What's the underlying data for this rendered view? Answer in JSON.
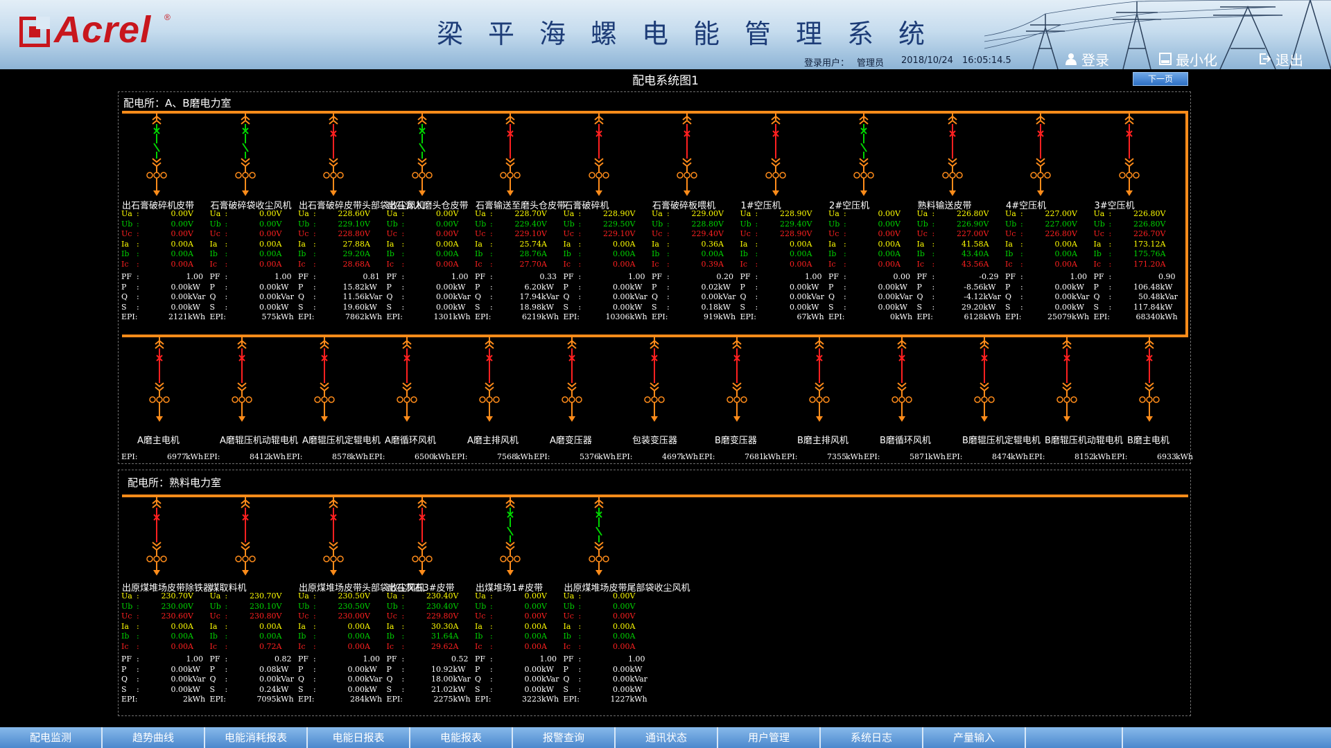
{
  "header": {
    "logo_text": "Acrel",
    "logo_reg": "®",
    "app_title": "梁平海螺电能管理系统",
    "user_label": "登录用户：",
    "user_name": "管理员",
    "date": "2018/10/24",
    "time": "16:05:14.5",
    "login_label": "登录",
    "minimize_label": "最小化",
    "exit_label": "退出"
  },
  "page_title": "配电系统图1",
  "next_page_label": "下一页",
  "colors": {
    "bus": "#ff8c1a",
    "closed": "#00d400",
    "open": "#ff2020",
    "ua": "#ffff00",
    "ub": "#00d400",
    "uc": "#ff2020"
  },
  "section1": {
    "title": "配电所：A、B磨电力室",
    "feeders": [
      {
        "name": "出石膏破碎机皮带",
        "state": "closed",
        "ua": "0.00",
        "ub": "0.00",
        "uc": "0.00",
        "ia": "0.00",
        "ib": "0.00",
        "ic": "0.00",
        "pf": "1.00",
        "p": "0.00",
        "q": "0.00",
        "s": "0.00",
        "epi": "2121"
      },
      {
        "name": "石膏破碎袋收尘风机",
        "state": "closed",
        "ua": "0.00",
        "ub": "0.00",
        "uc": "0.00",
        "ia": "0.00",
        "ib": "0.00",
        "ic": "0.00",
        "pf": "1.00",
        "p": "0.00",
        "q": "0.00",
        "s": "0.00",
        "epi": "575"
      },
      {
        "name": "出石膏破碎皮带头部袋收尘风机",
        "state": "open",
        "ua": "228.60",
        "ub": "229.10",
        "uc": "228.80",
        "ia": "27.88",
        "ib": "29.20",
        "ic": "28.68",
        "pf": "0.81",
        "p": "15.82",
        "q": "11.56",
        "s": "19.60",
        "epi": "7862"
      },
      {
        "name": "出石膏入磨头仓皮带",
        "state": "closed",
        "ua": "0.00",
        "ub": "0.00",
        "uc": "0.00",
        "ia": "0.00",
        "ib": "0.00",
        "ic": "0.00",
        "pf": "1.00",
        "p": "0.00",
        "q": "0.00",
        "s": "0.00",
        "epi": "1301"
      },
      {
        "name": "石膏输送至磨头仓皮带",
        "state": "open",
        "ua": "228.70",
        "ub": "229.40",
        "uc": "229.10",
        "ia": "25.74",
        "ib": "28.76",
        "ic": "27.70",
        "pf": "0.33",
        "p": "6.20",
        "q": "17.94",
        "s": "18.98",
        "epi": "6219"
      },
      {
        "name": "石膏破碎机",
        "state": "open",
        "ua": "228.90",
        "ub": "229.50",
        "uc": "229.10",
        "ia": "0.00",
        "ib": "0.00",
        "ic": "0.00",
        "pf": "1.00",
        "p": "0.00",
        "q": "0.00",
        "s": "0.00",
        "epi": "10306"
      },
      {
        "name": "石膏破碎板喂机",
        "state": "open",
        "ua": "229.00",
        "ub": "228.80",
        "uc": "229.40",
        "ia": "0.36",
        "ib": "0.00",
        "ic": "0.39",
        "pf": "0.20",
        "p": "0.02",
        "q": "0.00",
        "s": "0.18",
        "epi": "919"
      },
      {
        "name": "1#空压机",
        "state": "open",
        "ua": "228.90",
        "ub": "229.40",
        "uc": "228.90",
        "ia": "0.00",
        "ib": "0.00",
        "ic": "0.00",
        "pf": "1.00",
        "p": "0.00",
        "q": "0.00",
        "s": "0.00",
        "epi": "67"
      },
      {
        "name": "2#空压机",
        "state": "closed",
        "ua": "0.00",
        "ub": "0.00",
        "uc": "0.00",
        "ia": "0.00",
        "ib": "0.00",
        "ic": "0.00",
        "pf": "0.00",
        "p": "0.00",
        "q": "0.00",
        "s": "0.00",
        "epi": "0"
      },
      {
        "name": "熟料输送皮带",
        "state": "open",
        "ua": "226.80",
        "ub": "226.90",
        "uc": "227.00",
        "ia": "41.58",
        "ib": "43.40",
        "ic": "43.56",
        "pf": "-0.29",
        "p": "-8.56",
        "q": "-4.12",
        "s": "29.20",
        "epi": "6128"
      },
      {
        "name": "4#空压机",
        "state": "open",
        "ua": "227.00",
        "ub": "227.00",
        "uc": "226.80",
        "ia": "0.00",
        "ib": "0.00",
        "ic": "0.00",
        "pf": "1.00",
        "p": "0.00",
        "q": "0.00",
        "s": "0.00",
        "epi": "25079"
      },
      {
        "name": "3#空压机",
        "state": "open",
        "ua": "226.80",
        "ub": "226.80",
        "uc": "226.70",
        "ia": "173.12",
        "ib": "175.76",
        "ic": "171.20",
        "pf": "0.90",
        "p": "106.48",
        "q": "50.48",
        "s": "117.84",
        "epi": "68340"
      }
    ],
    "lower_feeders": [
      {
        "name": "A磨主电机",
        "epi": "6977"
      },
      {
        "name": "A磨辊压机动辊电机",
        "epi": "8412"
      },
      {
        "name": "A磨辊压机定辊电机",
        "epi": "8578"
      },
      {
        "name": "A磨循环风机",
        "epi": "6500"
      },
      {
        "name": "A磨主排风机",
        "epi": "7568"
      },
      {
        "name": "A磨变压器",
        "epi": "5376"
      },
      {
        "name": "包装变压器",
        "epi": "4697"
      },
      {
        "name": "B磨变压器",
        "epi": "7681"
      },
      {
        "name": "B磨主排风机",
        "epi": "7355"
      },
      {
        "name": "B磨循环风机",
        "epi": "5871"
      },
      {
        "name": "B磨辊压机定辊电机",
        "epi": "8474"
      },
      {
        "name": "B磨辊压机动辊电机",
        "epi": "8152"
      },
      {
        "name": "B磨主电机",
        "epi": "6933"
      }
    ]
  },
  "section2": {
    "title": "配电所：熟料电力室",
    "feeders": [
      {
        "name": "出原煤堆场皮带除铁器",
        "state": "open",
        "ua": "230.70",
        "ub": "230.00",
        "uc": "230.60",
        "ia": "0.00",
        "ib": "0.00",
        "ic": "0.00",
        "pf": "1.00",
        "p": "0.00",
        "q": "0.00",
        "s": "0.00",
        "epi": "2"
      },
      {
        "name": "煤取料机",
        "state": "open",
        "ua": "230.70",
        "ub": "230.10",
        "uc": "230.80",
        "ia": "0.00",
        "ib": "0.00",
        "ic": "0.72",
        "pf": "0.82",
        "p": "0.08",
        "q": "0.00",
        "s": "0.24",
        "epi": "7095"
      },
      {
        "name": "出原煤堆场皮带头部袋收尘风机",
        "state": "open",
        "ua": "230.50",
        "ub": "230.50",
        "uc": "230.00",
        "ia": "0.00",
        "ib": "0.00",
        "ic": "0.00",
        "pf": "1.00",
        "p": "0.00",
        "q": "0.00",
        "s": "0.00",
        "epi": "284"
      },
      {
        "name": "出石灰石3#皮带",
        "state": "open",
        "ua": "230.40",
        "ub": "230.40",
        "uc": "229.80",
        "ia": "30.30",
        "ib": "31.64",
        "ic": "29.62",
        "pf": "0.52",
        "p": "10.92",
        "q": "18.00",
        "s": "21.02",
        "epi": "2275"
      },
      {
        "name": "出煤堆场1#皮带",
        "state": "closed",
        "ua": "0.00",
        "ub": "0.00",
        "uc": "0.00",
        "ia": "0.00",
        "ib": "0.00",
        "ic": "0.00",
        "pf": "1.00",
        "p": "0.00",
        "q": "0.00",
        "s": "0.00",
        "epi": "3223"
      },
      {
        "name": "出原煤堆场皮带尾部袋收尘风机",
        "state": "closed",
        "ua": "0.00",
        "ub": "0.00",
        "uc": "0.00",
        "ia": "0.00",
        "ib": "0.00",
        "ic": "0.00",
        "pf": "1.00",
        "p": "0.00",
        "q": "0.00",
        "s": "0.00",
        "epi": "1227"
      }
    ]
  },
  "units": {
    "v": "V",
    "a": "A",
    "kw": "kW",
    "kvar": "kVar",
    "kwh": "kWh"
  },
  "labels": {
    "ua": "Ua",
    "ub": "Ub",
    "uc": "Uc",
    "ia": "Ia",
    "ib": "Ib",
    "ic": "Ic",
    "pf": "PF",
    "p": "P",
    "q": "Q",
    "s": "S",
    "epi": "EPI:",
    "colon": ":"
  },
  "nav": [
    "配电监测",
    "趋势曲线",
    "电能消耗报表",
    "电能日报表",
    "电能报表",
    "报警查询",
    "通讯状态",
    "用户管理",
    "系统日志",
    "产量输入"
  ]
}
